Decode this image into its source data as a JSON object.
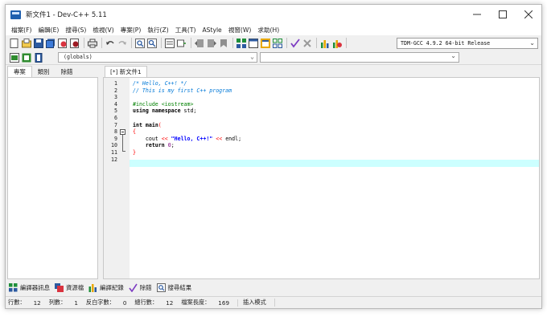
{
  "window": {
    "title": "新文件1 - Dev-C++ 5.11"
  },
  "menu": [
    "檔案(F)",
    "編輯(E)",
    "搜尋(S)",
    "檢視(V)",
    "專案(P)",
    "執行(Z)",
    "工具(T)",
    "AStyle",
    "視窗(W)",
    "求助(H)"
  ],
  "toolbar": {
    "compiler": "TDM-GCC 4.9.2 64-bit Release"
  },
  "toolbar2": {
    "scope": "(globals)"
  },
  "left_panel": {
    "tabs": [
      "專案",
      "類別",
      "除錯"
    ]
  },
  "editor": {
    "tab": "[*] 新文件1"
  },
  "code_lines": [
    "/* Hello, C++! */",
    "// This is my first C++ program",
    "",
    "#include <iostream>",
    "using namespace std;",
    "",
    "int main(",
    "{",
    "    cout << \"Hello, C++!\" << endl;",
    "    return 0;",
    "}",
    ""
  ],
  "bottom_tabs": [
    "編譯器訊息",
    "資源檔",
    "編譯紀錄",
    "除錯",
    "搜尋結果"
  ],
  "statusbar": {
    "line_label": "行數：",
    "line_value": "12",
    "col_label": "列數：",
    "col_value": "1",
    "sel_label": "反白字數：",
    "sel_value": "0",
    "total_label": "總行數：",
    "total_value": "12",
    "length_label": "檔案長度：",
    "length_value": "169",
    "mode": "插入模式"
  },
  "colors": {
    "current_line": "#ccffff",
    "comment": "#0078d7",
    "preprocessor": "#008000",
    "string": "#0000ff",
    "operator": "#ff0000",
    "number": "#800080"
  }
}
